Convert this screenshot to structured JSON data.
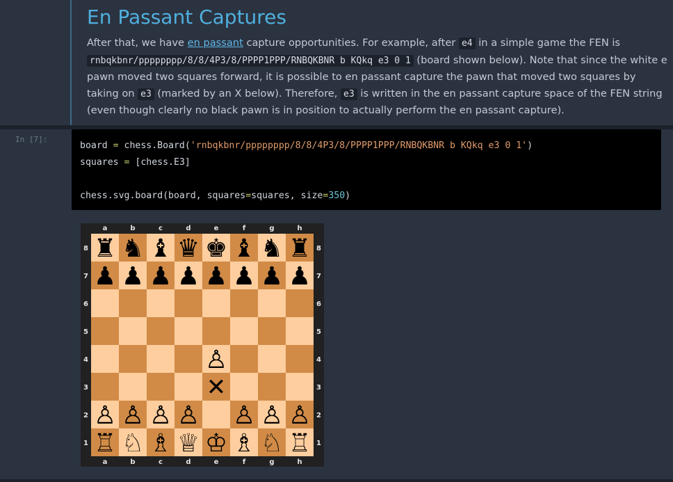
{
  "markdown": {
    "title": "En Passant Captures",
    "p_part1": "After that, we have ",
    "p_link": "en passant",
    "p_part2": " capture opportunities. For example, after ",
    "p_code1": "e4",
    "p_part3": " in a simple game the FEN is ",
    "p_code_fen": "rnbqkbnr/pppppppp/8/8/4P3/8/PPPP1PPP/RNBQKBNR b KQkq e3 0 1",
    "p_part4": " (board shown below). Note that since the white e pawn moved two squares forward, it is possible to en passant capture the pawn that moved two squares by taking on ",
    "p_code2": "e3",
    "p_part5": " (marked by an X below). Therefore, ",
    "p_code3": "e3",
    "p_part6": " is written in the en passant capture space of the FEN string (even though clearly no black pawn is in position to actually perform the en passant capture)."
  },
  "code_cell": {
    "prompt": "In [7]:",
    "line1_a": "board ",
    "line1_eq": "=",
    "line1_b": " chess.Board(",
    "line1_str": "'rnbqkbnr/pppppppp/8/8/4P3/8/PPPP1PPP/RNBQKBNR b KQkq e3 0 1'",
    "line1_c": ")",
    "line2_a": "squares ",
    "line2_eq": "=",
    "line2_b": " [chess.E3]",
    "line3_a": "chess.svg.board(board, squares",
    "line3_eq1": "=",
    "line3_b": "squares, size",
    "line3_eq2": "=",
    "line3_num": "350",
    "line3_c": ")"
  },
  "board": {
    "files": [
      "a",
      "b",
      "c",
      "d",
      "e",
      "f",
      "g",
      "h"
    ],
    "ranks": [
      "8",
      "7",
      "6",
      "5",
      "4",
      "3",
      "2",
      "1"
    ],
    "light_color": "#ffce9e",
    "dark_color": "#d18b47",
    "border_color": "#212121",
    "coord_color": "#e5e5e5",
    "marked_square": "e3",
    "marked_glyph": "✕",
    "pieces": {
      "8": [
        "♜",
        "♞",
        "♝",
        "♛",
        "♚",
        "♝",
        "♞",
        "♜"
      ],
      "7": [
        "♟",
        "♟",
        "♟",
        "♟",
        "♟",
        "♟",
        "♟",
        "♟"
      ],
      "6": [
        "",
        "",
        "",
        "",
        "",
        "",
        "",
        ""
      ],
      "5": [
        "",
        "",
        "",
        "",
        "",
        "",
        "",
        ""
      ],
      "4": [
        "",
        "",
        "",
        "",
        "♙",
        "",
        "",
        ""
      ],
      "3": [
        "",
        "",
        "",
        "",
        "",
        "",
        "",
        ""
      ],
      "2": [
        "♙",
        "♙",
        "♙",
        "♙",
        "",
        "♙",
        "♙",
        "♙"
      ],
      "1": [
        "♖",
        "♘",
        "♗",
        "♕",
        "♔",
        "♗",
        "♘",
        "♖"
      ]
    }
  }
}
